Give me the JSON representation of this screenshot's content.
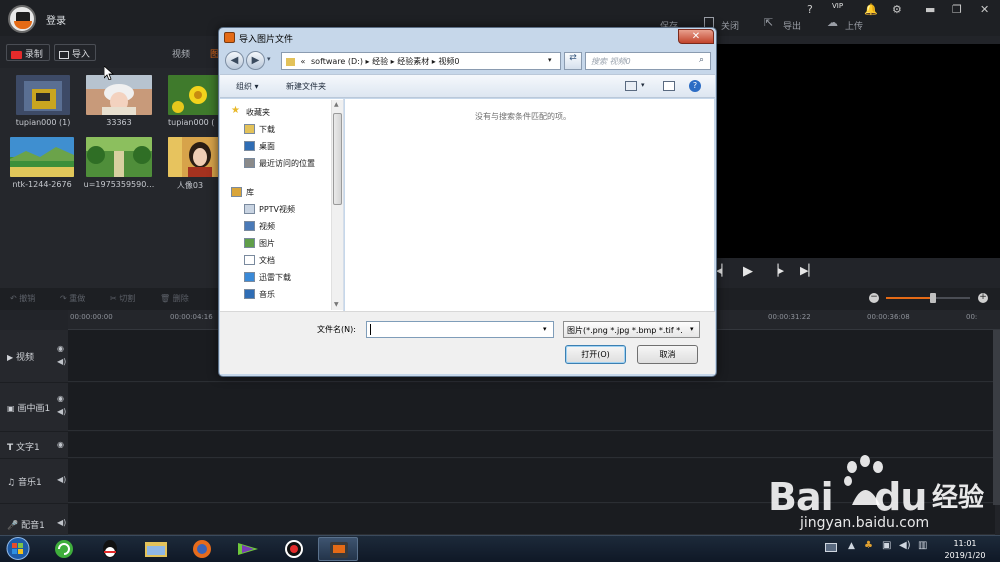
{
  "app": {
    "login": "登录",
    "top_actions": [
      "保存",
      "关闭",
      "导出",
      "上传"
    ],
    "record": "录制",
    "import": "导入",
    "tabs": [
      "视频",
      "图"
    ],
    "media": [
      {
        "label": "tupian000 (1)",
        "color": "#3d4a66"
      },
      {
        "label": "33363",
        "color": "#c89a7a"
      },
      {
        "label": "tupian000 (",
        "color": "#d9c23a"
      },
      {
        "label": "ntk-1244-2676",
        "color": "#3f8fd0"
      },
      {
        "label": "u=1975359590…",
        "color": "#4f8e3a"
      },
      {
        "label": "人像03",
        "color": "#d7a34a"
      }
    ],
    "edit_actions": [
      "撤销",
      "重做",
      "切割",
      "删除"
    ],
    "ruler_ticks": [
      "00:00:00:00",
      "00:00:04:16",
      "00:00:31:22",
      "00:00:36:08",
      "00:"
    ],
    "tracks": [
      "视频",
      "画中画1",
      "文字1",
      "音乐1",
      "配音1"
    ],
    "vip": "VIP"
  },
  "dialog": {
    "title": "导入图片文件",
    "close": "✕",
    "address": [
      "«",
      "software (D:)",
      "经验",
      "经验素材",
      "视频0"
    ],
    "search_placeholder": "搜索 视频0",
    "organize": "组织 ▾",
    "new_folder": "新建文件夹",
    "nav_items": [
      {
        "label": "收藏夹",
        "icon": "star-icon",
        "indent": false
      },
      {
        "label": "下载",
        "icon": "download-folder-icon",
        "indent": true
      },
      {
        "label": "桌面",
        "icon": "desktop-icon",
        "indent": true
      },
      {
        "label": "最近访问的位置",
        "icon": "recent-places-icon",
        "indent": true
      },
      {
        "label": "库",
        "icon": "library-icon",
        "indent": false
      },
      {
        "label": "PPTV视频",
        "icon": "library-folder-icon",
        "indent": true
      },
      {
        "label": "视频",
        "icon": "video-library-icon",
        "indent": true
      },
      {
        "label": "图片",
        "icon": "picture-library-icon",
        "indent": true
      },
      {
        "label": "文档",
        "icon": "document-library-icon",
        "indent": true
      },
      {
        "label": "迅雷下载",
        "icon": "thunder-download-icon",
        "indent": true
      },
      {
        "label": "音乐",
        "icon": "music-library-icon",
        "indent": true
      }
    ],
    "empty_message": "没有与搜索条件匹配的项。",
    "filename_label": "文件名(N):",
    "filename_value": "",
    "filetype": "图片(*.png *.jpg *.bmp *.tif *.",
    "open": "打开(O)",
    "cancel": "取消"
  },
  "taskbar": {
    "time": "11:01",
    "date": "2019/1/20"
  },
  "watermark": {
    "brand": "Bai",
    "brand2": "du",
    "cn": "经验",
    "url": "jingyan.baidu.com"
  }
}
